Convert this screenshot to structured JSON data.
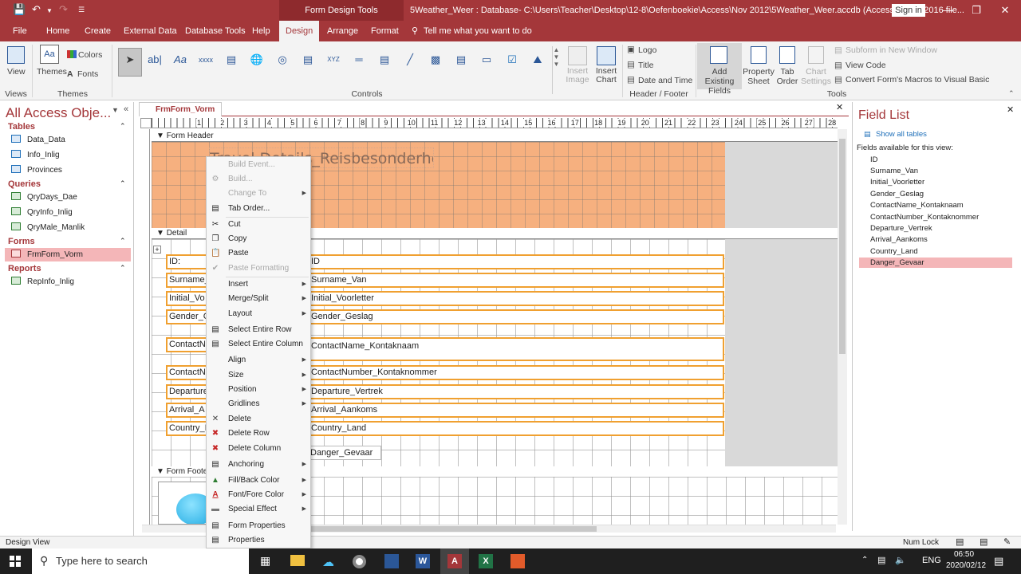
{
  "titlebar": {
    "context_tools": "Form Design Tools",
    "document_title": "5Weather_Weer : Database- C:\\Users\\Teacher\\Desktop\\12-8\\Oefenboekie\\Access\\Nov 2012\\5Weather_Weer.accdb (Access 2007 - 2016 file...",
    "signin_label": "Sign in"
  },
  "ribbon_tabs": [
    "File",
    "Home",
    "Create",
    "External Data",
    "Database Tools",
    "Help",
    "Design",
    "Arrange",
    "Format"
  ],
  "ribbon_tabs_active": "Design",
  "tell_me": "Tell me what you want to do",
  "ribbon": {
    "view_label": "View",
    "themes_label": "Themes",
    "colors_label": "Colors",
    "fonts_label": "Fonts",
    "insert_image_label": "Insert Image",
    "insert_chart_label": "Insert Chart",
    "logo_label": "Logo",
    "title_label": "Title",
    "date_time_label": "Date and Time",
    "add_fields_label": "Add Existing Fields",
    "property_sheet_label": "Property Sheet",
    "tab_order_label": "Tab Order",
    "chart_settings_label": "Chart Settings",
    "subform_label": "Subform in New Window",
    "view_code_label": "View Code",
    "convert_macros_label": "Convert Form's Macros to Visual Basic",
    "groups": {
      "views": "Views",
      "themes": "Themes",
      "controls": "Controls",
      "header_footer": "Header / Footer",
      "tools": "Tools"
    }
  },
  "nav": {
    "title": "All Access Obje...",
    "sections": [
      {
        "label": "Tables",
        "items": [
          "Data_Data",
          "Info_Inlig",
          "Provinces"
        ]
      },
      {
        "label": "Queries",
        "items": [
          "QryDays_Dae",
          "QryInfo_Inlig",
          "QryMale_Manlik"
        ]
      },
      {
        "label": "Forms",
        "items": [
          "FrmForm_Vorm"
        ]
      },
      {
        "label": "Reports",
        "items": [
          "RepInfo_Inlig"
        ]
      }
    ],
    "selected": "FrmForm_Vorm"
  },
  "document": {
    "tab_label": "FrmForm_Vorm",
    "form_header_label": "Form Header",
    "detail_label": "Detail",
    "form_footer_label": "Form Footer",
    "header_title": "Travel Details_Reisbesonderhe",
    "labels": [
      "ID:",
      "Surname_",
      "Initial_Vo",
      "Gender_G",
      "ContactN",
      "ContactN",
      "Departure",
      "Arrival_A",
      "Country_I"
    ],
    "fields": [
      "ID",
      "Surname_Van",
      "Initial_Voorletter",
      "Gender_Geslag",
      "ContactName_Kontaknaam",
      "ContactNumber_Kontaknommer",
      "Departure_Vertrek",
      "Arrival_Aankoms",
      "Country_Land"
    ],
    "danger_field": "Danger_Gevaar",
    "ruler_numbers": [
      "1",
      "2",
      "3",
      "4",
      "5",
      "6",
      "7",
      "8",
      "9",
      "10",
      "11",
      "12",
      "13",
      "14",
      "15",
      "16",
      "17",
      "18",
      "19",
      "20",
      "21",
      "22",
      "23",
      "24",
      "25",
      "26",
      "27",
      "28"
    ]
  },
  "context_menu": [
    {
      "label": "Build Event...",
      "disabled": true,
      "icon": ""
    },
    {
      "label": "Build...",
      "disabled": true,
      "icon": "build-icon"
    },
    {
      "label": "Change To",
      "disabled": true,
      "submenu": true,
      "icon": ""
    },
    {
      "label": "Tab Order...",
      "icon": "tab-order-icon"
    },
    {
      "label": "Cut",
      "icon": "cut-icon"
    },
    {
      "label": "Copy",
      "icon": "copy-icon"
    },
    {
      "label": "Paste",
      "icon": "paste-icon"
    },
    {
      "label": "Paste Formatting",
      "disabled": true,
      "icon": "paste-formatting-icon"
    },
    {
      "label": "Insert",
      "submenu": true,
      "icon": ""
    },
    {
      "label": "Merge/Split",
      "submenu": true,
      "icon": ""
    },
    {
      "label": "Layout",
      "submenu": true,
      "icon": ""
    },
    {
      "label": "Select Entire Row",
      "icon": "select-row-icon"
    },
    {
      "label": "Select Entire Column",
      "icon": "select-column-icon"
    },
    {
      "label": "Align",
      "submenu": true,
      "icon": ""
    },
    {
      "label": "Size",
      "submenu": true,
      "icon": ""
    },
    {
      "label": "Position",
      "submenu": true,
      "icon": ""
    },
    {
      "label": "Gridlines",
      "submenu": true,
      "icon": ""
    },
    {
      "label": "Delete",
      "icon": "delete-icon"
    },
    {
      "label": "Delete Row",
      "icon": "delete-row-icon"
    },
    {
      "label": "Delete Column",
      "icon": "delete-column-icon"
    },
    {
      "label": "Anchoring",
      "submenu": true,
      "icon": "anchoring-icon"
    },
    {
      "label": "Fill/Back Color",
      "submenu": true,
      "icon": "fill-color-icon"
    },
    {
      "label": "Font/Fore Color",
      "submenu": true,
      "icon": "font-color-icon"
    },
    {
      "label": "Special Effect",
      "submenu": true,
      "icon": "special-effect-icon"
    },
    {
      "label": "Form Properties",
      "icon": "form-properties-icon"
    },
    {
      "label": "Properties",
      "icon": "properties-icon"
    }
  ],
  "field_list": {
    "title": "Field List",
    "show_all": "Show all tables",
    "available": "Fields available for this view:",
    "fields": [
      "ID",
      "Surname_Van",
      "Initial_Voorletter",
      "Gender_Geslag",
      "ContactName_Kontaknaam",
      "ContactNumber_Kontaknommer",
      "Departure_Vertrek",
      "Arrival_Aankoms",
      "Country_Land",
      "Danger_Gevaar"
    ],
    "selected": "Danger_Gevaar"
  },
  "statusbar": {
    "left": "Design View",
    "num_lock": "Num Lock"
  },
  "taskbar": {
    "search_placeholder": "Type here to search",
    "lang": "ENG",
    "time": "06:50",
    "date": "2020/02/12"
  },
  "colors": {
    "access_red": "#a4373a",
    "header_orange": "#f6b07f",
    "selection_pink": "#f4b6b8",
    "field_border": "#f0a030"
  }
}
